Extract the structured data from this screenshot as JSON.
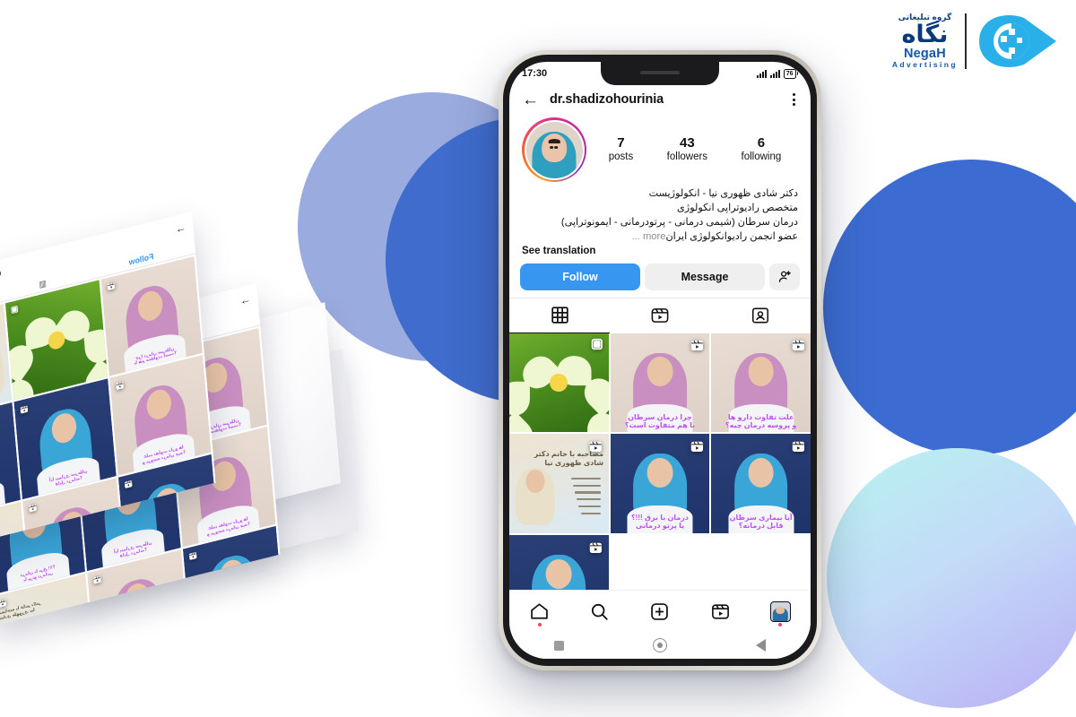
{
  "brand": {
    "fa_tagline": "گروه تبلیغاتی",
    "fa_name": "نگاه",
    "en_name": "NegaH",
    "en_sub": "Advertising",
    "accent": "#29b0e8",
    "dark_blue": "#0b3a7a"
  },
  "phone": {
    "status": {
      "time": "17:30",
      "battery": "76"
    },
    "topbar": {
      "back_icon": "back-arrow-icon",
      "username": "dr.shadizohourinia",
      "menu_icon": "kebab-menu-icon"
    },
    "profile": {
      "stats": [
        {
          "number": "7",
          "label": "posts"
        },
        {
          "number": "43",
          "label": "followers"
        },
        {
          "number": "6",
          "label": "following"
        }
      ],
      "bio_lines": [
        "دکتر شادی ظهوری نیا - انکولوژیست",
        "متخصص رادیوتراپی انکولوژی",
        "درمان سرطان (شیمی درمانی - پرتودرمانی - ایمونوتراپی)",
        "عضو انجمن رادیوانکولوژی ایران"
      ],
      "more_label": "... more",
      "see_translation": "See translation"
    },
    "actions": {
      "follow": "Follow",
      "message": "Message",
      "add_user_icon": "add-person-icon",
      "follow_color": "#3797f0",
      "message_color": "#efeff0"
    },
    "tabs": [
      {
        "name": "grid",
        "icon": "grid-icon",
        "active": true
      },
      {
        "name": "reels",
        "icon": "reels-icon",
        "active": false
      },
      {
        "name": "tagged",
        "icon": "tagged-icon",
        "active": false
      }
    ],
    "posts": [
      {
        "id": 1,
        "kind": "lotus",
        "badge": "carousel-icon",
        "caption": ""
      },
      {
        "id": 2,
        "kind": "person",
        "badge": "reel-icon",
        "caption_lines": [
          "چرا درمان سرطان",
          "با هم متفاوت است؟"
        ],
        "scarf": "#c98fc0",
        "bg": "#e9dcd2"
      },
      {
        "id": 3,
        "kind": "person",
        "badge": "reel-icon",
        "caption_lines": [
          "علت تفاوت دارو ها",
          "و پروسه درمان چیه؟"
        ],
        "scarf": "#c98fc0",
        "bg": "#e9dcd2"
      },
      {
        "id": 4,
        "kind": "poster",
        "badge": "reel-icon",
        "poster_title": [
          "مصاحبه با خانم دکتر",
          "شادی ظهوری نیا"
        ],
        "scarf": "#e8e0c9",
        "bg": "#dfe9f2"
      },
      {
        "id": 5,
        "kind": "person",
        "badge": "reel-icon",
        "caption_lines": [
          "درمان با برق !!!؟",
          "یا پرتو درمانی"
        ],
        "scarf": "#3aa6d8",
        "bg": "#2a3f76"
      },
      {
        "id": 6,
        "kind": "person",
        "badge": "reel-icon",
        "caption_lines": [
          "آیا بیماری سرطان",
          "قابل درمانه؟"
        ],
        "scarf": "#3aa6d8",
        "bg": "#2a3f76"
      },
      {
        "id": 7,
        "kind": "person",
        "badge": "reel-icon",
        "caption_lines": [],
        "scarf": "#3aa6d8",
        "bg": "#2a3f76"
      }
    ],
    "bottom_nav": [
      {
        "name": "home",
        "icon": "home-icon",
        "dot": true
      },
      {
        "name": "search",
        "icon": "search-icon",
        "dot": false
      },
      {
        "name": "create",
        "icon": "plus-box-icon",
        "dot": false
      },
      {
        "name": "reels",
        "icon": "reels-icon",
        "dot": false
      },
      {
        "name": "profile",
        "icon": "profile-avatar-icon",
        "dot": true
      }
    ],
    "android_nav": [
      {
        "name": "recents",
        "icon": "square-icon"
      },
      {
        "name": "home",
        "icon": "circle-icon"
      },
      {
        "name": "back",
        "icon": "triangle-back-icon"
      }
    ]
  },
  "tilted_cards": {
    "mini_username": "dr.shadizohourinia",
    "mini_follow": "Follow",
    "mini_arrow": "→"
  },
  "background": {
    "circle_periwinkle": "#9aabdf",
    "circle_blue_left": "#3f6ccd",
    "circle_blue_right": "#3c6cd1",
    "circle_gradient_from": "#b7f3ef",
    "circle_gradient_to": "#b9aef6"
  }
}
